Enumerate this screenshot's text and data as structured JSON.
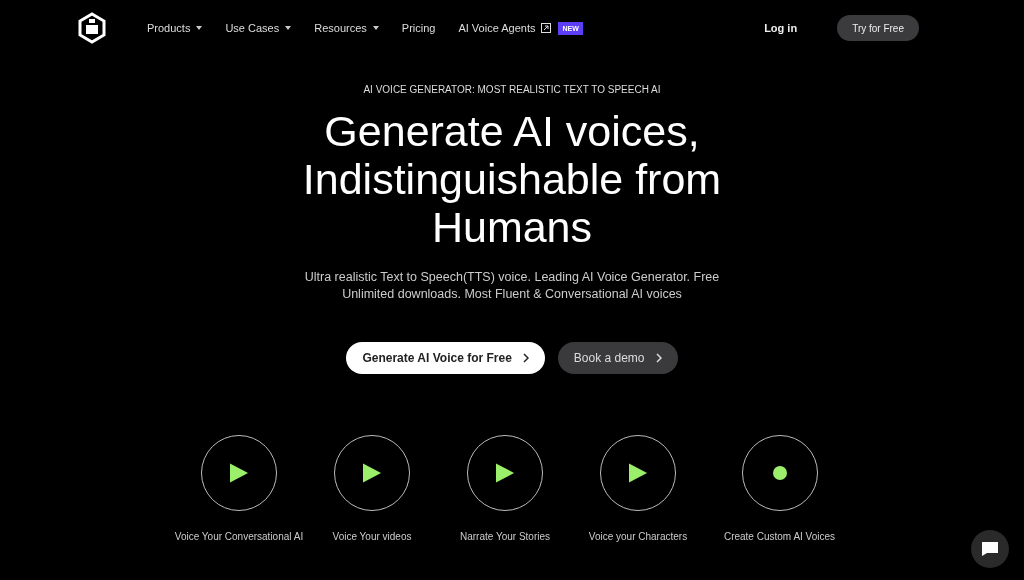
{
  "nav": {
    "items": [
      {
        "label": "Products",
        "kind": "dropdown"
      },
      {
        "label": "Use Cases",
        "kind": "dropdown"
      },
      {
        "label": "Resources",
        "kind": "dropdown"
      },
      {
        "label": "Pricing",
        "kind": "plain"
      },
      {
        "label": "AI Voice Agents",
        "kind": "external",
        "badge": "NEW"
      }
    ],
    "login": "Log in",
    "cta": "Try for Free"
  },
  "hero": {
    "eyebrow": "AI VOICE GENERATOR: MOST REALISTIC TEXT TO SPEECH AI",
    "title_lines": [
      "Generate AI voices,",
      "Indistinguishable from",
      "Humans"
    ],
    "subtitle": "Ultra realistic Text to Speech(TTS) voice. Leading AI Voice Generator. Free Unlimited downloads. Most Fluent & Conversational AI voices",
    "buttons": [
      {
        "label": "Generate AI Voice for Free",
        "kind": "primary"
      },
      {
        "label": "Book a demo",
        "kind": "secondary"
      }
    ]
  },
  "features": [
    {
      "label": "Voice Your Conversational AI",
      "kind": "play"
    },
    {
      "label": "Voice Your videos",
      "kind": "play"
    },
    {
      "label": "Narrate Your Stories",
      "kind": "play"
    },
    {
      "label": "Voice your Characters",
      "kind": "play"
    },
    {
      "label": "Create Custom AI Voices",
      "kind": "record"
    }
  ]
}
